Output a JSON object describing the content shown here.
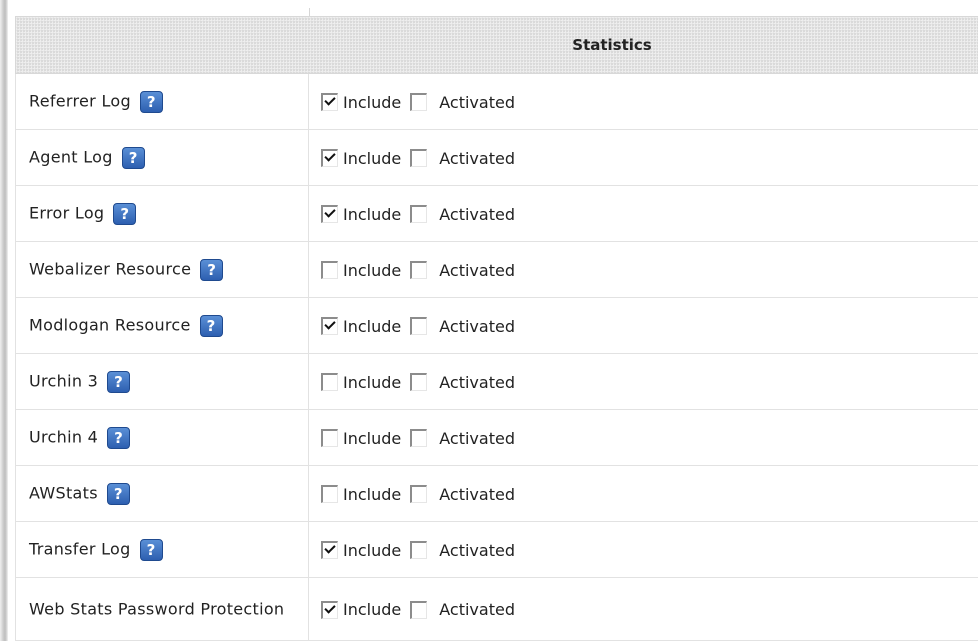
{
  "table": {
    "header": "Statistics",
    "help_glyph": "?",
    "rows": [
      {
        "label": "Referrer Log",
        "include_label": "Include",
        "activated_label": "Activated",
        "include_checked": true,
        "activated_checked": false
      },
      {
        "label": "Agent Log",
        "include_label": "Include",
        "activated_label": "Activated",
        "include_checked": true,
        "activated_checked": false
      },
      {
        "label": "Error Log",
        "include_label": "Include",
        "activated_label": "Activated",
        "include_checked": true,
        "activated_checked": false
      },
      {
        "label": "Webalizer Resource",
        "include_label": "Include",
        "activated_label": "Activated",
        "include_checked": false,
        "activated_checked": false
      },
      {
        "label": "Modlogan Resource",
        "include_label": "Include",
        "activated_label": "Activated",
        "include_checked": true,
        "activated_checked": false
      },
      {
        "label": "Urchin 3",
        "include_label": "Include",
        "activated_label": "Activated",
        "include_checked": false,
        "activated_checked": false
      },
      {
        "label": "Urchin 4",
        "include_label": "Include",
        "activated_label": "Activated",
        "include_checked": false,
        "activated_checked": false
      },
      {
        "label": "AWStats",
        "include_label": "Include",
        "activated_label": "Activated",
        "include_checked": false,
        "activated_checked": false
      },
      {
        "label": "Transfer Log",
        "include_label": "Include",
        "activated_label": "Activated",
        "include_checked": true,
        "activated_checked": false
      },
      {
        "label": "Web Stats Password Protection",
        "include_label": "Include",
        "activated_label": "Activated",
        "include_checked": true,
        "activated_checked": false
      }
    ]
  }
}
